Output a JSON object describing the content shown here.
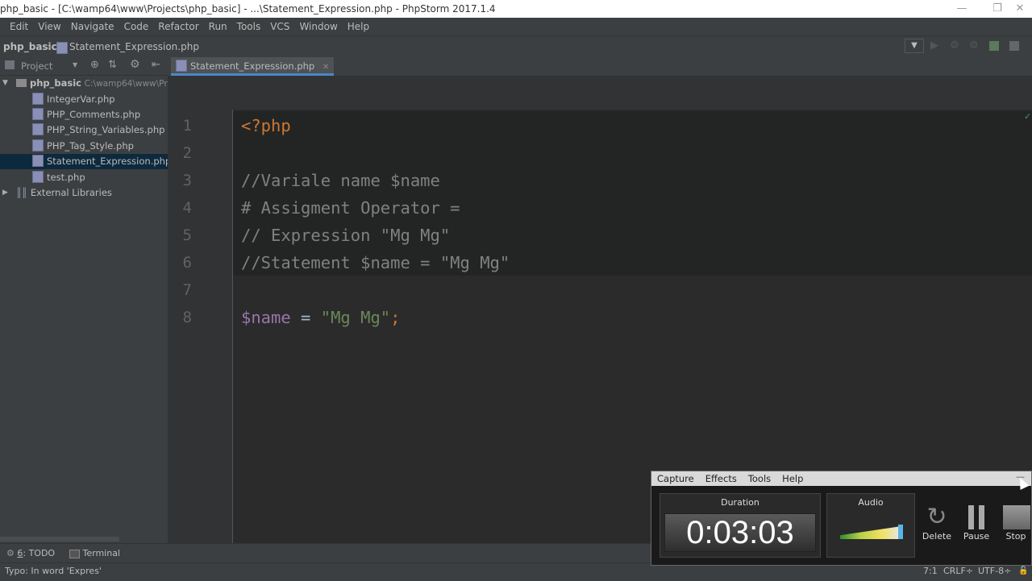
{
  "titlebar": {
    "title": "php_basic - [C:\\wamp64\\www\\Projects\\php_basic] - ...\\Statement_Expression.php - PhpStorm 2017.1.4"
  },
  "menu": [
    "Edit",
    "View",
    "Navigate",
    "Code",
    "Refactor",
    "Run",
    "Tools",
    "VCS",
    "Window",
    "Help"
  ],
  "navbar": {
    "project": "php_basic",
    "file": "Statement_Expression.php"
  },
  "project_panel": {
    "view_label": "Project",
    "root": {
      "name": "php_basic",
      "path": "C:\\wamp64\\www\\Pro"
    },
    "files": [
      "IntegerVar.php",
      "PHP_Comments.php",
      "PHP_String_Variables.php",
      "PHP_Tag_Style.php",
      "Statement_Expression.php",
      "test.php"
    ],
    "selected": "Statement_Expression.php",
    "external": "External Libraries"
  },
  "editor": {
    "tab": "Statement_Expression.php",
    "line_numbers": [
      "1",
      "2",
      "3",
      "4",
      "5",
      "6",
      "7",
      "8"
    ],
    "lines": {
      "l1": "<?php",
      "l3": "//Variale name $name",
      "l4": "# Assigment Operator =",
      "l5": "// Expression \"Mg Mg\"",
      "l6": "//Statement $name = \"Mg Mg\"",
      "l8_var": "$name",
      "l8_eq": " = ",
      "l8_str": "\"Mg Mg\"",
      "l8_semi": ";"
    }
  },
  "bottom_tools": {
    "todo_num": "6",
    "todo": ": TODO",
    "terminal": "Terminal"
  },
  "status": {
    "message": "Typo: In word 'Expres'",
    "position": "7:1",
    "line_sep": "CRLF÷",
    "encoding": "UTF-8÷"
  },
  "recorder": {
    "menu": [
      "Capture",
      "Effects",
      "Tools",
      "Help"
    ],
    "duration_label": "Duration",
    "duration": "0:03:03",
    "audio_label": "Audio",
    "buttons": {
      "delete": "Delete",
      "pause": "Pause",
      "stop": "Stop"
    }
  }
}
